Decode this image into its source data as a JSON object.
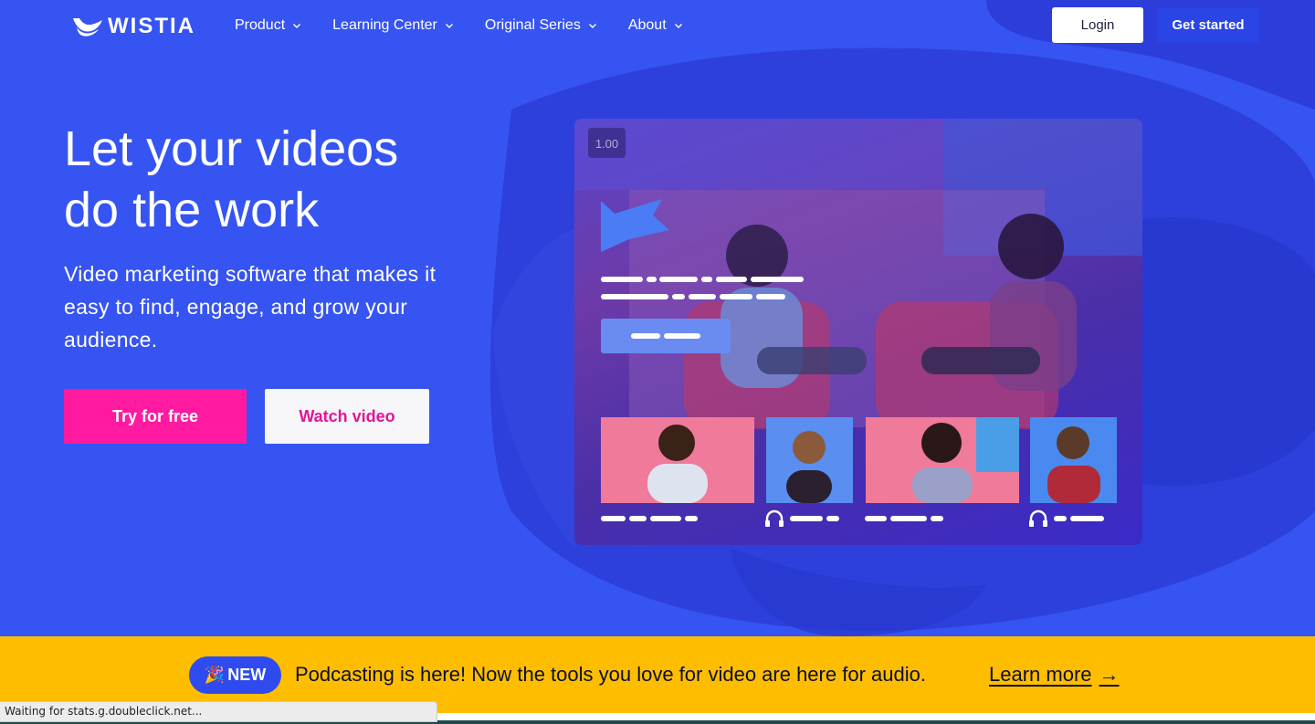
{
  "nav": {
    "logo_text": "WISTIA",
    "items": [
      {
        "label": "Product"
      },
      {
        "label": "Learning Center"
      },
      {
        "label": "Original Series"
      },
      {
        "label": "About"
      }
    ],
    "login_label": "Login",
    "get_started_label": "Get started"
  },
  "hero": {
    "headline_line1": "Let your videos",
    "headline_line2": "do the work",
    "subhead": "Video marketing software that makes it easy to find, engage, and grow your audience.",
    "try_label": "Try for free",
    "watch_label": "Watch video",
    "video": {
      "playback_speed": "1.00"
    }
  },
  "banner": {
    "badge_emoji": "🎉",
    "badge_label": "NEW",
    "message": "Podcasting is here! Now the tools you love for video are here for audio.",
    "link_label": "Learn more",
    "link_arrow": "→"
  },
  "status_bar": {
    "text": "Waiting for stats.g.doubleclick.net..."
  },
  "colors": {
    "hero_bg": "#3654f2",
    "brush": "#2a3cd8",
    "try_button": "#ff1aa0",
    "watch_text": "#e3149a",
    "banner_bg": "#ffbd00",
    "new_pill": "#2f4bf0"
  }
}
